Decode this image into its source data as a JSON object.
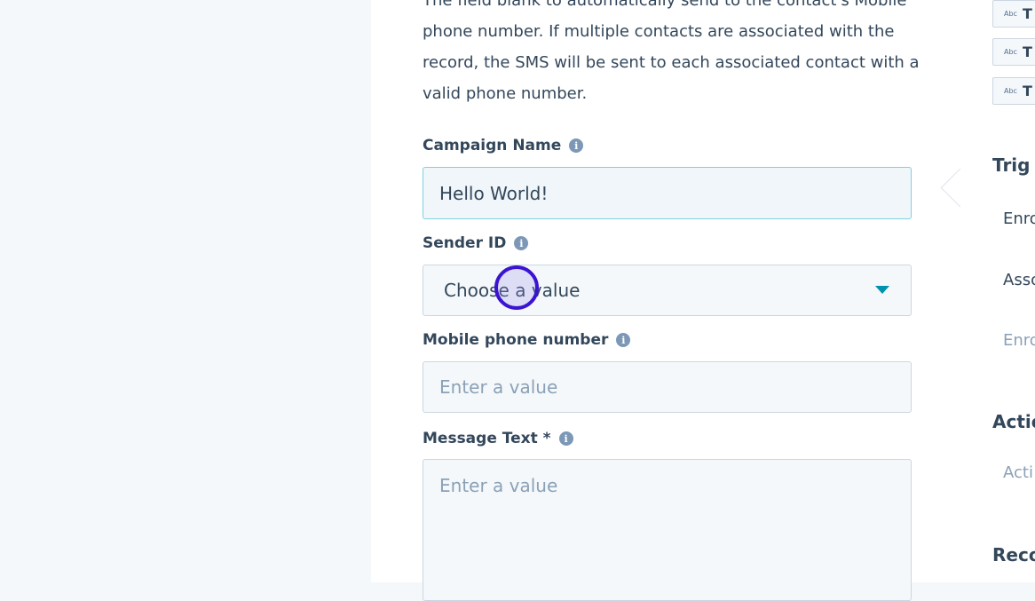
{
  "form": {
    "description": "The field blank to automatically send to the contact's Mobile phone number. If multiple contacts are associated with the record, the SMS will be sent to each associated contact with a valid phone number.",
    "campaign_name": {
      "label": "Campaign Name",
      "value": "Hello World!"
    },
    "sender_id": {
      "label": "Sender ID",
      "placeholder": "Choose a value"
    },
    "mobile_phone": {
      "label": "Mobile phone number",
      "placeholder": "Enter a value"
    },
    "message_text": {
      "label": "Message Text *",
      "placeholder": "Enter a value"
    }
  },
  "right_panel": {
    "tokens": [
      "T",
      "T",
      "T"
    ],
    "token_badge": "Abc",
    "sections": [
      {
        "heading": "Trig",
        "items": [
          "Enro",
          "Asso",
          "Enro"
        ]
      },
      {
        "heading": "Actio",
        "items": [
          "Acti"
        ]
      },
      {
        "heading": "Reco",
        "items": []
      }
    ]
  },
  "colors": {
    "accent": "#0091ae",
    "focus_border": "#7fd1de",
    "click_marker": "#3b14d1",
    "text": "#33475b",
    "placeholder": "#8aa1b7"
  }
}
